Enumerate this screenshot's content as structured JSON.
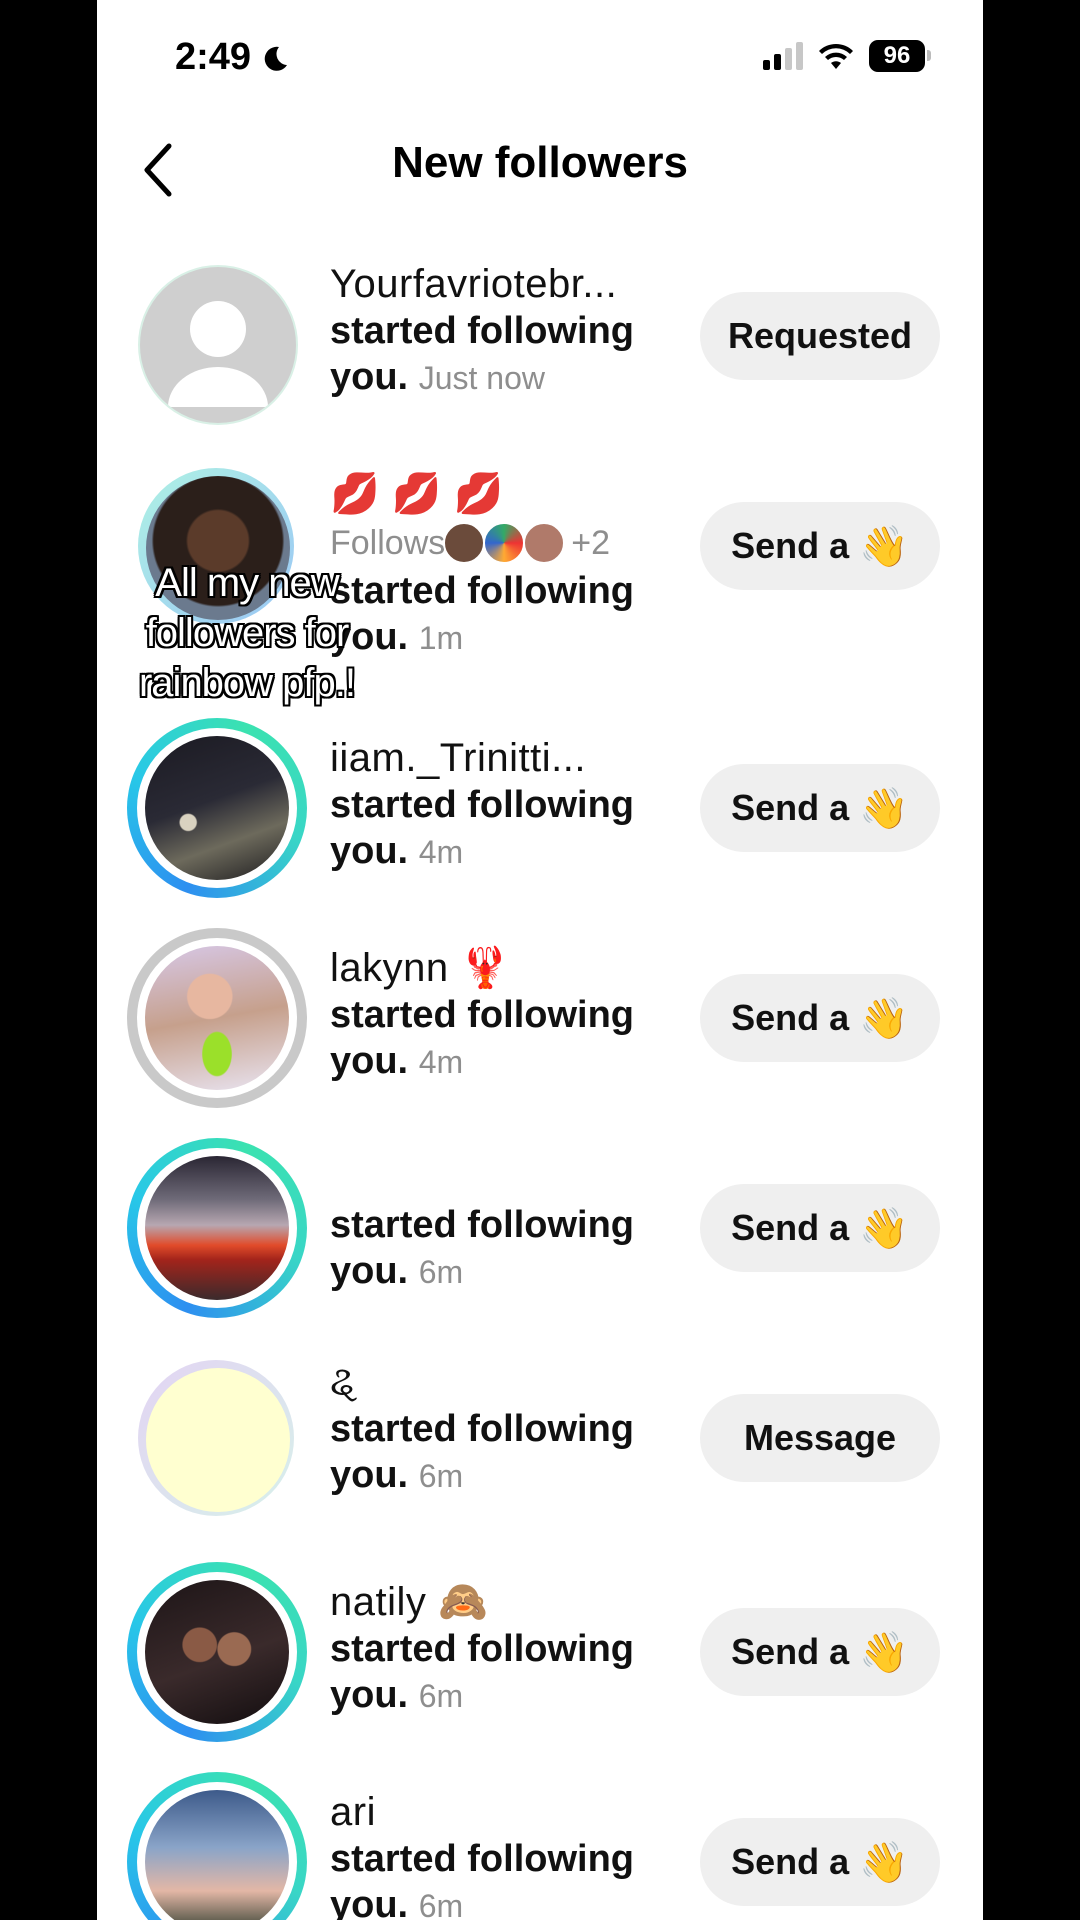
{
  "status": {
    "time": "2:49",
    "battery": "96"
  },
  "header": {
    "title": "New followers"
  },
  "overlay_caption": "All my new followers for rainbow pfp.!",
  "rows": [
    {
      "name": "Yourfavriotebr...",
      "action": "started following",
      "you": "you.",
      "time": "Just now",
      "button": "Requested"
    },
    {
      "name": "💋 💋 💋",
      "follows_label": "Follows",
      "follows_more": "+2",
      "action": "started following",
      "you": "you.",
      "time": "1m",
      "button": "Send a"
    },
    {
      "name": "iiam._Trinitti...",
      "action": "started following",
      "you": "you.",
      "time": "4m",
      "button": "Send a"
    },
    {
      "name": "lakynn 🦞",
      "action": "started following",
      "you": "you.",
      "time": "4m",
      "button": "Send a"
    },
    {
      "name": "",
      "action": "started following",
      "you": "you.",
      "time": "6m",
      "button": "Send a"
    },
    {
      "name": "ୡ",
      "action": "started following",
      "you": "you.",
      "time": "6m",
      "button": "Message"
    },
    {
      "name": "natily 🙈",
      "action": "started following",
      "you": "you.",
      "time": "6m",
      "button": "Send a"
    },
    {
      "name": "ari",
      "action": "started following",
      "you": "you.",
      "time": "6m",
      "button": "Send a"
    }
  ],
  "wave_emoji": "👋"
}
